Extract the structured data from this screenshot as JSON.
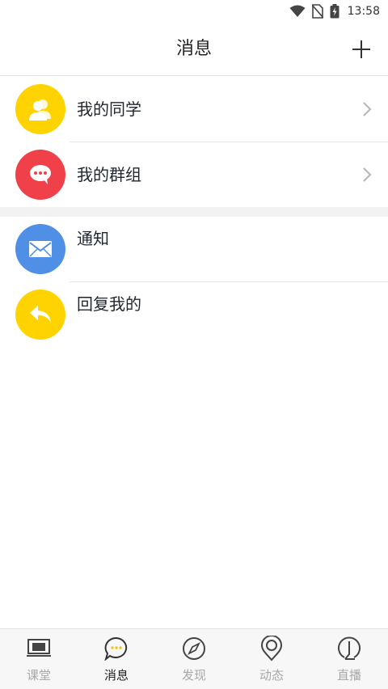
{
  "status_bar": {
    "time": "13:58"
  },
  "header": {
    "title": "消息"
  },
  "sections": {
    "contacts": [
      {
        "label": "我的同学",
        "icon": "classmates-icon",
        "color": "#FFD300"
      },
      {
        "label": "我的群组",
        "icon": "group-chat-icon",
        "color": "#F0404A"
      }
    ],
    "messages": [
      {
        "label": "通知",
        "icon": "mail-icon",
        "color": "#4F8FE6"
      },
      {
        "label": "回复我的",
        "icon": "reply-icon",
        "color": "#FFD300"
      }
    ]
  },
  "tab_bar": {
    "active": "消息",
    "tabs": [
      {
        "label": "课堂",
        "icon": "classroom-icon"
      },
      {
        "label": "消息",
        "icon": "message-icon"
      },
      {
        "label": "发现",
        "icon": "compass-icon"
      },
      {
        "label": "动态",
        "icon": "activity-icon"
      },
      {
        "label": "直播",
        "icon": "live-icon"
      }
    ]
  },
  "colors": {
    "accent": "#F5C518",
    "inactive": "#A8A8A8",
    "text": "#1F2630"
  }
}
